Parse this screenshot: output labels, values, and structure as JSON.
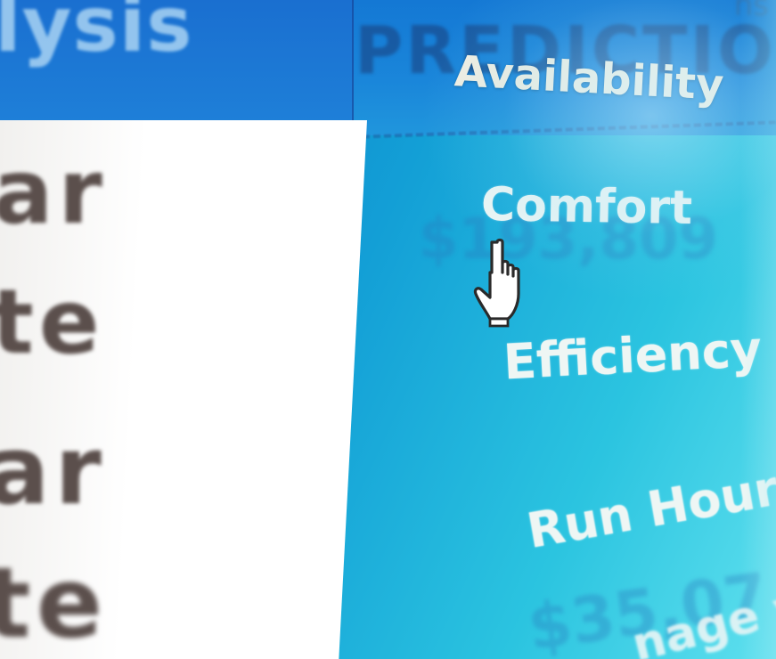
{
  "header": {
    "analysis_tab_label": "lysis",
    "prediction_label": "PREDICTION",
    "corner_fragment": "ns"
  },
  "left_panel": {
    "words": [
      "ar",
      "te",
      "ar",
      "te"
    ]
  },
  "menu": {
    "items": [
      {
        "label": "Availability"
      },
      {
        "label": "Comfort"
      },
      {
        "label": "Efficiency"
      },
      {
        "label": "Run Hours"
      },
      {
        "label": "nage v"
      }
    ]
  },
  "ghost_values": [
    "$193,809",
    "$35,07"
  ],
  "colors": {
    "background": "#139fd6",
    "header": "#1a86da",
    "menu_text": "#eef6f4",
    "panel": "#ffffff"
  },
  "icons": {
    "cursor": "hand-pointer-icon"
  }
}
